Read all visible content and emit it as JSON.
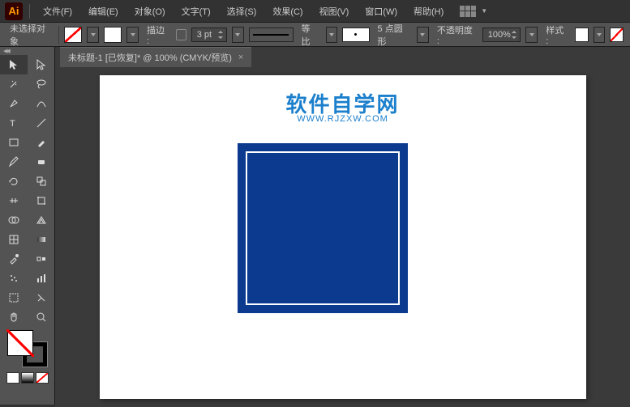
{
  "app": {
    "name": "Ai"
  },
  "menu": {
    "items": [
      "文件(F)",
      "编辑(E)",
      "对象(O)",
      "文字(T)",
      "选择(S)",
      "效果(C)",
      "视图(V)",
      "窗口(W)",
      "帮助(H)"
    ]
  },
  "options": {
    "selection_status": "未选择对象",
    "stroke_label": "描边 :",
    "stroke_width": "3 pt",
    "stroke_scale_label": "等比",
    "brush_label": "5 点圆形",
    "opacity_label": "不透明度 :",
    "opacity_value": "100%",
    "style_label": "样式 :"
  },
  "tab": {
    "title": "未标题-1 [已恢复]* @ 100% (CMYK/预览)",
    "close": "×"
  },
  "watermark": {
    "title": "软件自学网",
    "url": "WWW.RJZXW.COM"
  },
  "tools": {
    "names": [
      "selection",
      "direct-selection",
      "magic-wand",
      "lasso",
      "pen",
      "curvature",
      "type",
      "line",
      "rectangle",
      "paintbrush",
      "pencil",
      "eraser",
      "rotate",
      "scale",
      "width",
      "free-transform",
      "shape-builder",
      "perspective",
      "mesh",
      "gradient",
      "eyedropper",
      "blend",
      "symbol-sprayer",
      "column-graph",
      "artboard",
      "slice",
      "hand",
      "zoom"
    ]
  }
}
